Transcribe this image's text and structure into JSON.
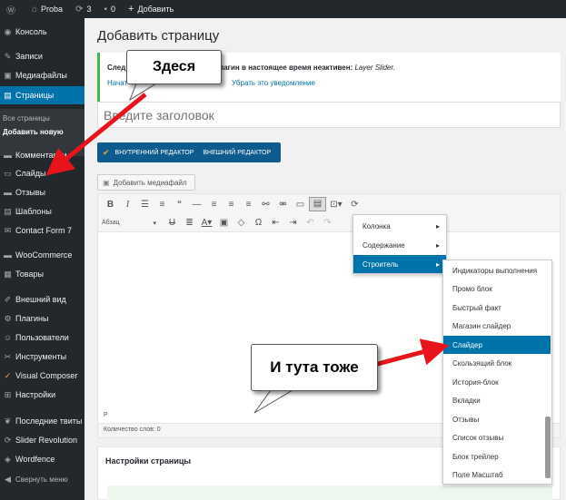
{
  "admin_bar": {
    "site_name": "Proba",
    "updates_count": "3",
    "comments_count": "0",
    "add_label": "Добавить"
  },
  "sidebar": {
    "items": [
      {
        "label": "Консоль",
        "icon": "dashboard-icon"
      },
      {
        "label": "Записи",
        "icon": "pin-icon"
      },
      {
        "label": "Медиафайлы",
        "icon": "media-icon"
      },
      {
        "label": "Страницы",
        "icon": "pages-icon"
      },
      {
        "label": "Комментарии",
        "icon": "comments-icon"
      },
      {
        "label": "Слайды",
        "icon": "slides-icon"
      },
      {
        "label": "Отзывы",
        "icon": "testimonials-icon"
      },
      {
        "label": "Шаблоны",
        "icon": "templates-icon"
      },
      {
        "label": "Contact Form 7",
        "icon": "mail-icon"
      },
      {
        "label": "WooCommerce",
        "icon": "woocommerce-icon"
      },
      {
        "label": "Товары",
        "icon": "products-icon"
      },
      {
        "label": "Внешний вид",
        "icon": "appearance-icon"
      },
      {
        "label": "Плагины",
        "icon": "plugins-icon"
      },
      {
        "label": "Пользователи",
        "icon": "users-icon"
      },
      {
        "label": "Инструменты",
        "icon": "tools-icon"
      },
      {
        "label": "Visual Composer",
        "icon": "visual-composer-icon"
      },
      {
        "label": "Настройки",
        "icon": "settings-icon"
      },
      {
        "label": "Последние твиты",
        "icon": "twitter-icon"
      },
      {
        "label": "Slider Revolution",
        "icon": "slider-revolution-icon"
      },
      {
        "label": "Wordfence",
        "icon": "wordfence-icon"
      },
      {
        "label": "Свернуть меню",
        "icon": "collapse-icon"
      }
    ],
    "submenu": {
      "all_pages": "Все страницы",
      "add_new": "Добавить новую"
    }
  },
  "main": {
    "page_title": "Добавить страницу",
    "notice": {
      "prefix": "След",
      "text_bold": "плагин в настоящее время неактивен:",
      "plugin_name": "Layer Slider.",
      "link1": "Начат",
      "link2": "Убрать это уведомление"
    },
    "title_placeholder": "Введите заголовок",
    "vc_buttons": {
      "inner_editor": "ВНУТРЕННИЙ РЕДАКТОР",
      "outer_editor": "ВНЕШНИЙ РЕДАКТОР"
    },
    "add_media_label": "Добавить медиафайл",
    "format_select": "Абзац",
    "editor_path": "P",
    "word_count": "Количество слов: 0",
    "page_settings_title": "Настройки страницы"
  },
  "dropdown_1": {
    "items": [
      "Колонка",
      "Содержание",
      "Строитель"
    ],
    "active_index": 2
  },
  "dropdown_2": {
    "items": [
      "Индикаторы выполнения",
      "Промо блок",
      "Быстрый факт",
      "Магазин слайдер",
      "Слайдер",
      "Скользящий блок",
      "История-блок",
      "Вкладки",
      "Отзывы",
      "Список отзывы",
      "Блок трейлер",
      "Поле Масштаб"
    ],
    "active_index": 4
  },
  "callouts": {
    "first": "Здеся",
    "second": "И тута тоже"
  },
  "colors": {
    "admin_dark": "#23282d",
    "accent_blue": "#0073aa",
    "vc_blue": "#0e5b8d",
    "arrow_red": "#e8141c"
  }
}
